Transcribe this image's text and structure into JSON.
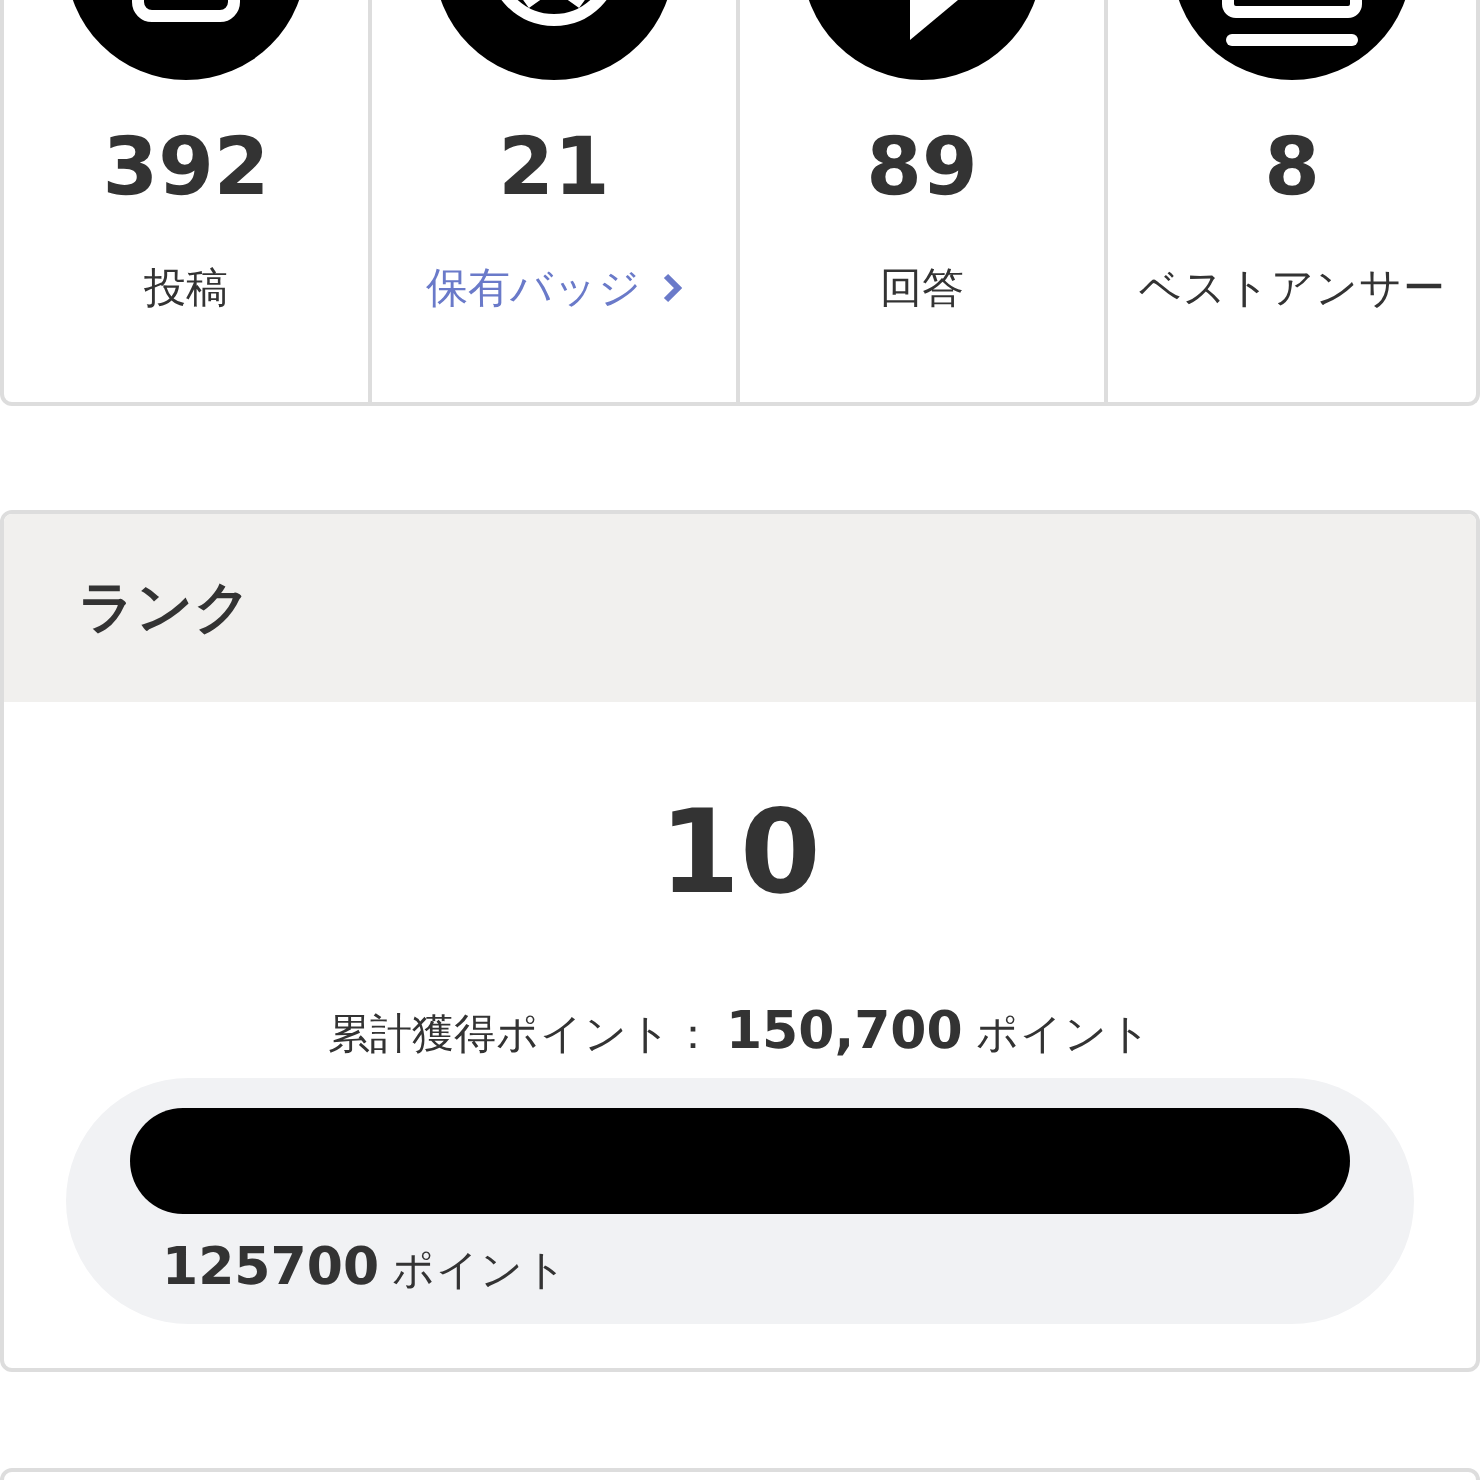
{
  "stats": [
    {
      "value": "392",
      "label": "投稿",
      "kind": "text"
    },
    {
      "value": "21",
      "label": "保有バッジ",
      "kind": "link"
    },
    {
      "value": "89",
      "label": "回答",
      "kind": "text"
    },
    {
      "value": "8",
      "label": "ベストアンサー",
      "kind": "text"
    }
  ],
  "rank": {
    "title": "ランク",
    "value": "10",
    "total_label": "累計獲得ポイント：",
    "total_value": "150,700",
    "total_unit": "ポイント",
    "progress": {
      "value": "125700",
      "unit": "ポイント"
    }
  }
}
